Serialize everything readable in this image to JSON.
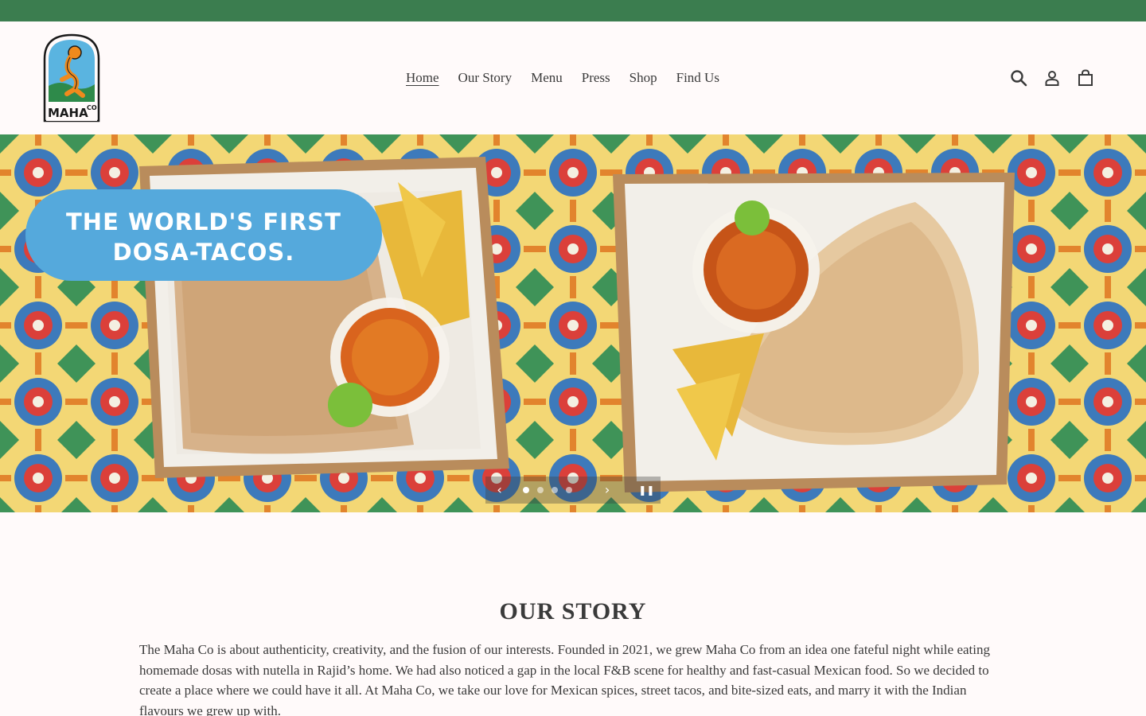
{
  "nav": {
    "items": [
      {
        "label": "Home",
        "active": true
      },
      {
        "label": "Our Story",
        "active": false
      },
      {
        "label": "Menu",
        "active": false
      },
      {
        "label": "Press",
        "active": false
      },
      {
        "label": "Shop",
        "active": false
      },
      {
        "label": "Find Us",
        "active": false
      }
    ]
  },
  "logo": {
    "text": "MAHA",
    "superscript": "CO"
  },
  "header_icons": [
    "search-icon",
    "account-icon",
    "cart-icon"
  ],
  "hero": {
    "headline_line1": "THE WORLD'S FIRST",
    "headline_line2": "DOSA-TACOS.",
    "slides_total": 4,
    "active_slide": 1
  },
  "story": {
    "title": "OUR STORY",
    "body": "The Maha Co is about authenticity, creativity, and the fusion of our interests. Founded in 2021, we grew Maha Co from an idea one fateful night while eating homemade dosas with nutella in Rajid’s home. We had also noticed a gap in the local F&B scene for healthy and fast-casual Mexican food. So we decided to create a place where we could have it all. At Maha Co, we take our love for Mexican spices, street tacos, and bite-sized eats, and marry it with the Indian flavours we grew up with."
  },
  "colors": {
    "announcement_bar": "#3b7d4f",
    "page_bg": "#fffafa",
    "hero_pill": "#55a9dc",
    "text": "#3a3a3a"
  }
}
